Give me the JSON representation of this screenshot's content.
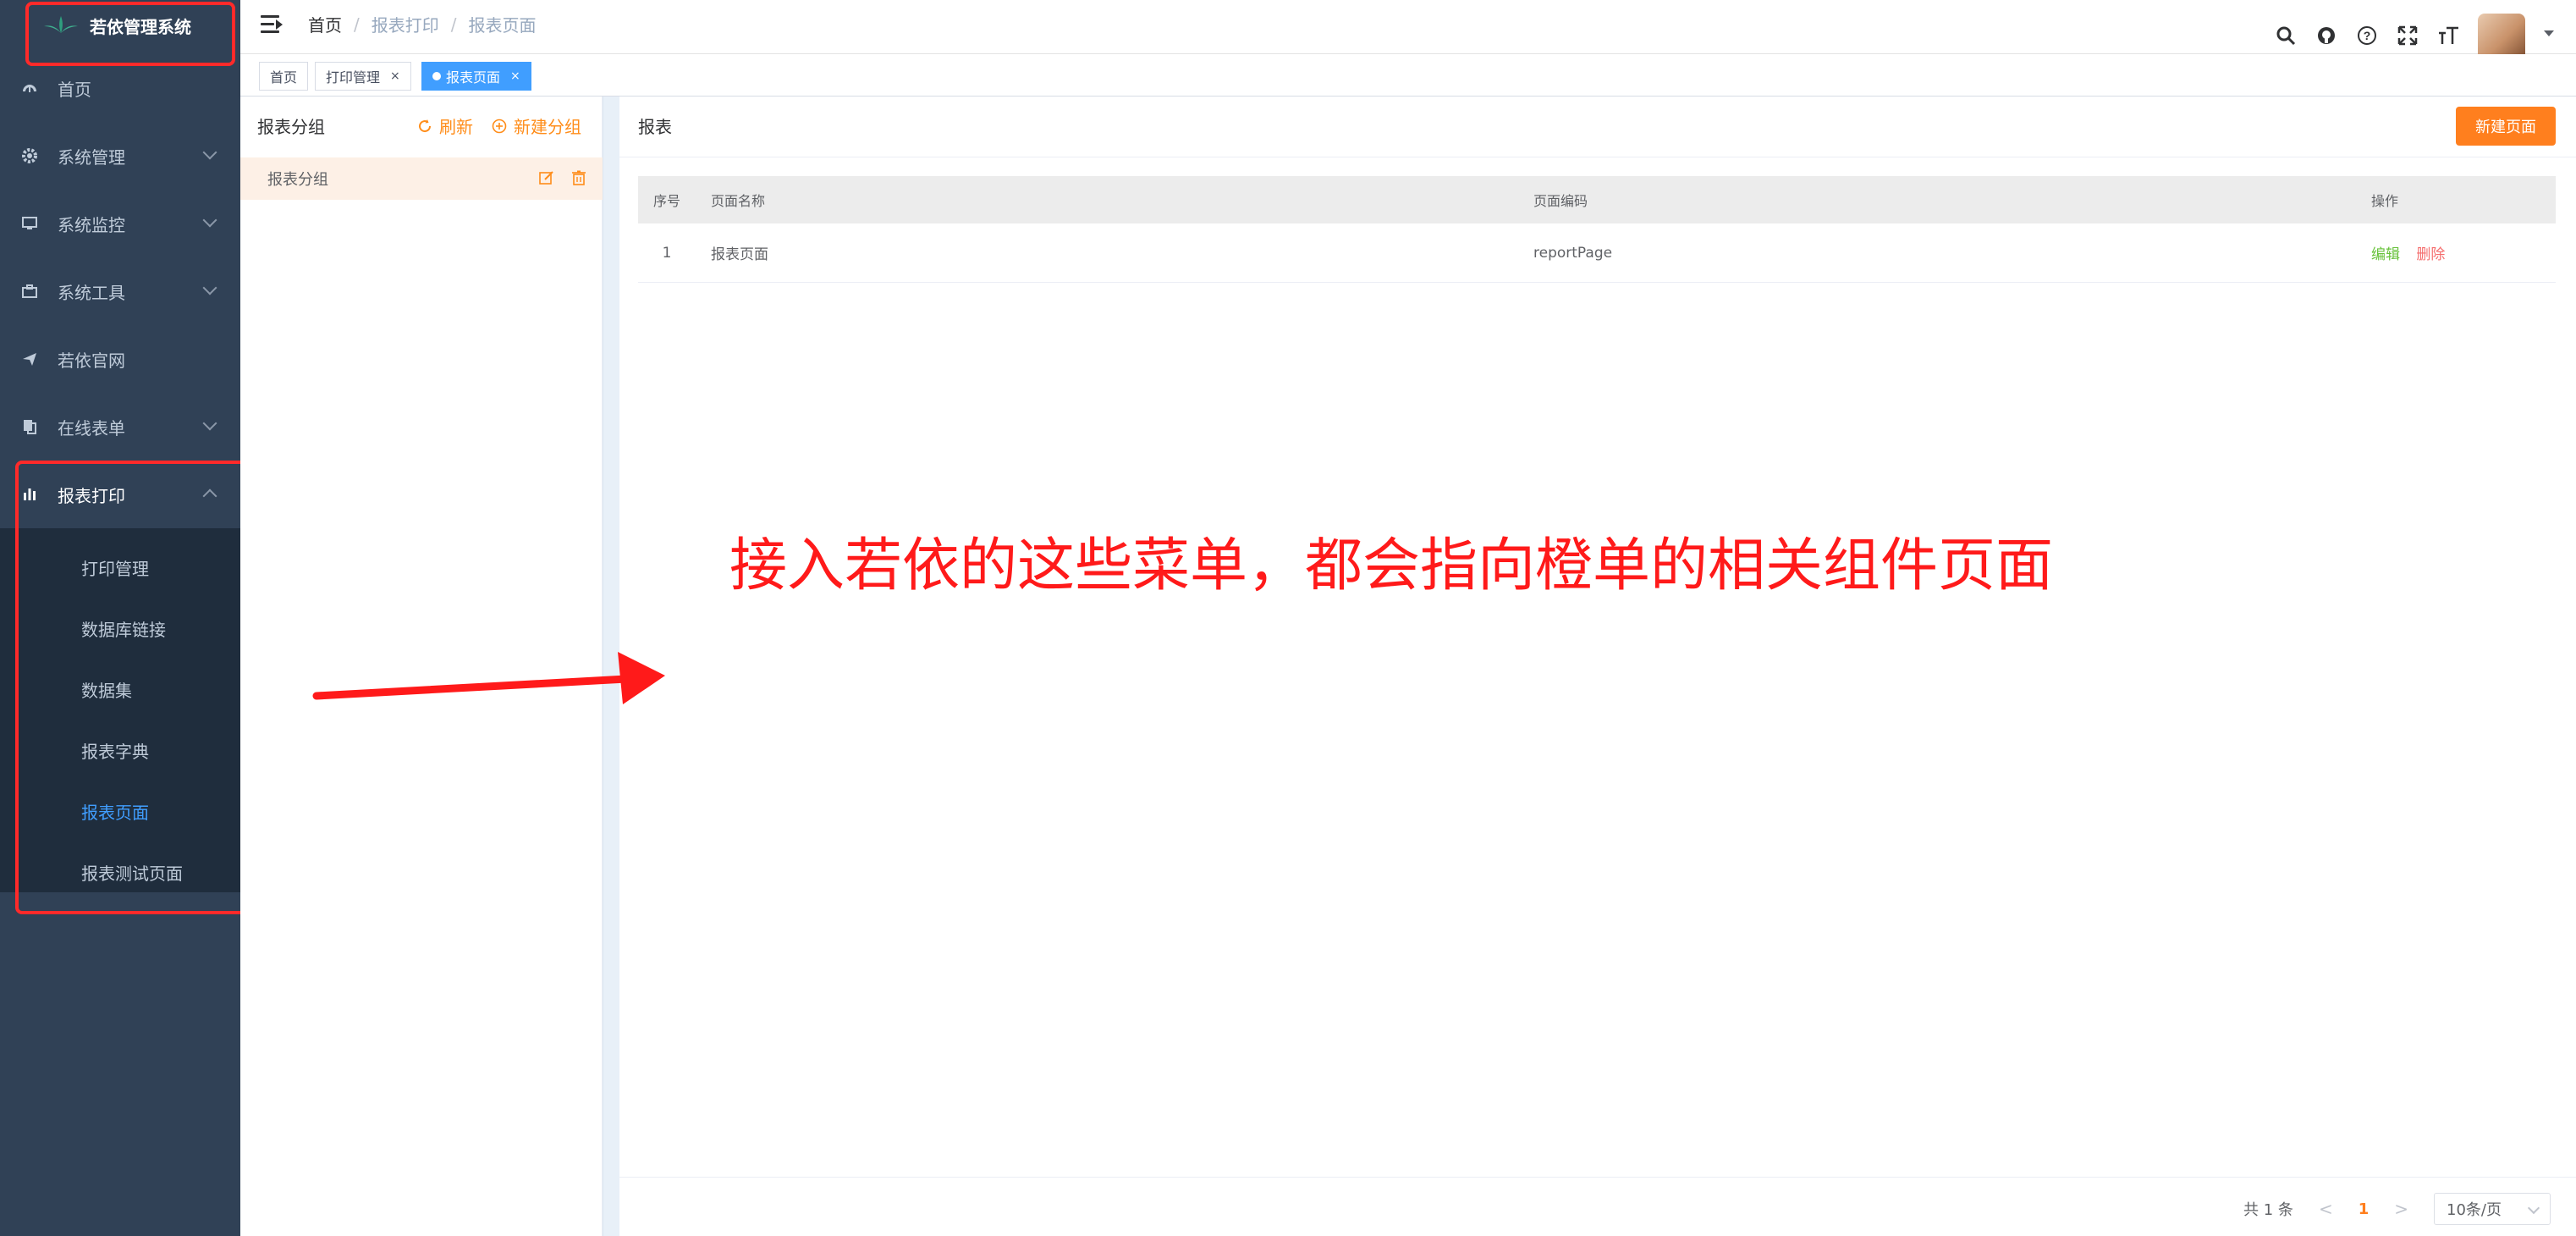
{
  "app": {
    "title": "若依管理系统"
  },
  "sidebar": {
    "items": [
      {
        "label": "首页",
        "icon": "dashboard-icon"
      },
      {
        "label": "系统管理",
        "icon": "gear-icon"
      },
      {
        "label": "系统监控",
        "icon": "monitor-icon"
      },
      {
        "label": "系统工具",
        "icon": "toolbox-icon"
      },
      {
        "label": "若依官网",
        "icon": "send-icon"
      },
      {
        "label": "在线表单",
        "icon": "copy-icon"
      },
      {
        "label": "报表打印",
        "icon": "bar-chart-icon"
      }
    ],
    "submenu": [
      {
        "label": "打印管理"
      },
      {
        "label": "数据库链接"
      },
      {
        "label": "数据集"
      },
      {
        "label": "报表字典"
      },
      {
        "label": "报表页面"
      },
      {
        "label": "报表测试页面"
      }
    ]
  },
  "breadcrumb": {
    "items": [
      "首页",
      "报表打印",
      "报表页面"
    ]
  },
  "tags": [
    {
      "label": "首页"
    },
    {
      "label": "打印管理",
      "close": "×"
    },
    {
      "label": "报表页面",
      "close": "×"
    }
  ],
  "left_panel": {
    "title": "报表分组",
    "refresh": "刷新",
    "new_group": "新建分组",
    "rows": [
      {
        "label": "报表分组"
      }
    ]
  },
  "main_panel": {
    "title": "报表",
    "new_button": "新建页面",
    "columns": [
      "序号",
      "页面名称",
      "页面编码",
      "操作"
    ],
    "rows": [
      {
        "index": "1",
        "name": "报表页面",
        "code": "reportPage",
        "edit": "编辑",
        "delete": "删除"
      }
    ]
  },
  "annotation": {
    "text": "接入若依的这些菜单，都会指向橙单的相关组件页面"
  },
  "pagination": {
    "total": "共 1 条",
    "current": "1",
    "page_size": "10条/页",
    "prev": "<",
    "next": ">"
  },
  "colors": {
    "sidebar_bg": "#304156",
    "submenu_bg": "#1f2d3d",
    "accent": "#409eff",
    "orange": "#ff7f1e",
    "annotation": "#ff1a1a"
  }
}
